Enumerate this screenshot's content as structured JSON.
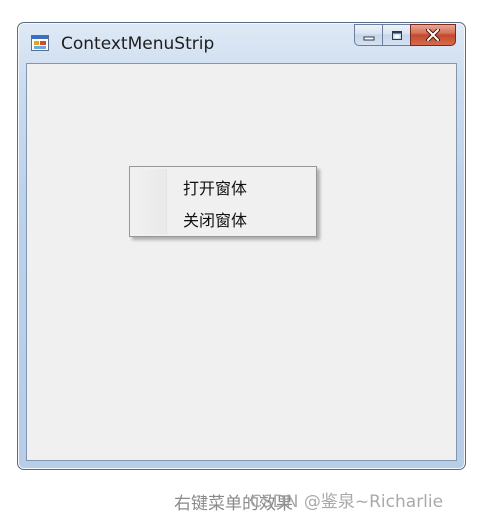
{
  "window": {
    "title": "ContextMenuStrip",
    "app_icon": "winforms-app-icon",
    "buttons": {
      "minimize_icon": "minimize-icon",
      "maximize_icon": "maximize-icon",
      "close_icon": "close-icon"
    }
  },
  "context_menu": {
    "items": [
      {
        "label": "打开窗体"
      },
      {
        "label": "关闭窗体"
      }
    ]
  },
  "caption": "右键菜单的效果",
  "watermark": "CSDN @鉴泉~Richarlie",
  "colors": {
    "close_button": "#c24a2e",
    "frame": "#b7cde8",
    "client_background": "#f0f0f0"
  }
}
